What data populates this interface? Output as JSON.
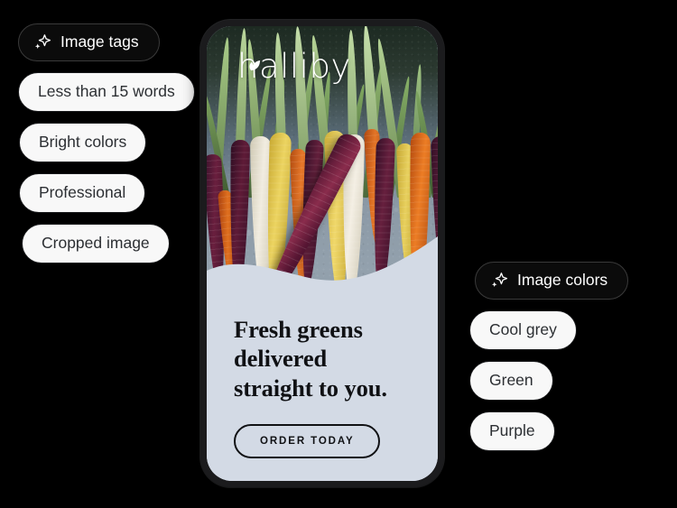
{
  "background_color": "#000000",
  "tags_panel": {
    "header": {
      "label": "Image tags",
      "icon": "sparkle-icon",
      "bg": "#0b0b0b",
      "text_color": "#ffffff"
    },
    "items": [
      {
        "label": "Less than 15 words"
      },
      {
        "label": "Bright colors"
      },
      {
        "label": "Professional"
      },
      {
        "label": "Cropped image"
      }
    ]
  },
  "colors_panel": {
    "header": {
      "label": "Image colors",
      "icon": "sparkle-icon",
      "bg": "#0b0b0b",
      "text_color": "#ffffff"
    },
    "items": [
      {
        "label": "Cool grey"
      },
      {
        "label": "Green"
      },
      {
        "label": "Purple"
      }
    ]
  },
  "phone_preview": {
    "brand": {
      "name": "halliby",
      "mark": "leaf-sprout-icon",
      "color": "#ffffff"
    },
    "headline_lines": [
      "Fresh greens",
      "delivered",
      "straight to you."
    ],
    "cta_label": "ORDER TODAY",
    "panel_color": "#d3dae5",
    "headline_color": "#101114",
    "image_subject": "rainbow-carrots-on-slate"
  },
  "palette": {
    "pill_fill": "#f8f8f8",
    "pill_border": "#17181a",
    "pill_text": "#2c2f33",
    "header_fill": "#0b0b0b",
    "header_border": "#3a3a3a",
    "phone_frame": "#1b1b1d"
  }
}
